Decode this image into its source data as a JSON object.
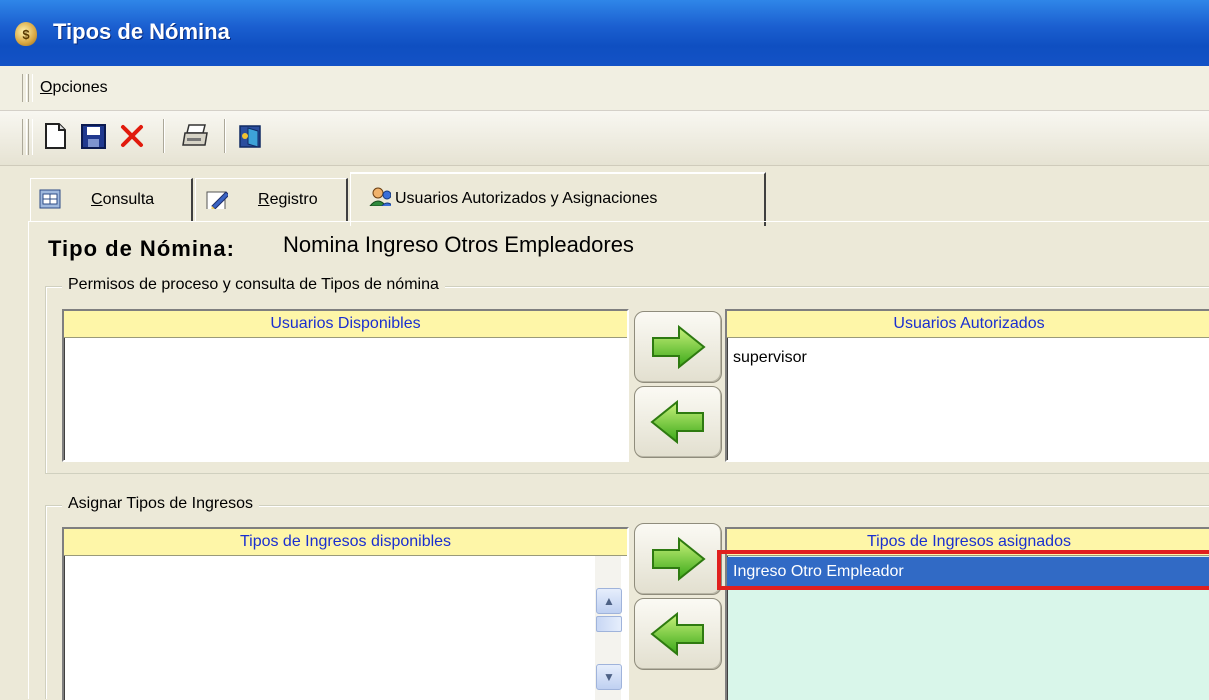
{
  "window": {
    "title": "Tipos de Nómina",
    "icon": "money-bag-icon"
  },
  "menu": {
    "items": [
      {
        "label_underlined": "O",
        "label_rest": "pciones"
      }
    ]
  },
  "toolbar": {
    "buttons": [
      "new-document-icon",
      "save-disk-icon",
      "delete-x-icon",
      "print-icon",
      "exit-door-icon"
    ]
  },
  "tabs": [
    {
      "underlined": "C",
      "rest": "onsulta",
      "icon": "query-grid-icon",
      "active": false
    },
    {
      "underlined": "R",
      "rest": "egistro",
      "icon": "edit-pencil-icon",
      "active": false
    },
    {
      "label": "Usuarios Autorizados y Asignaciones",
      "icon": "users-icon",
      "active": true
    }
  ],
  "tipo_nomina": {
    "label": "Tipo de Nómina:",
    "value": "Nomina Ingreso Otros Empleadores"
  },
  "permisos": {
    "title": "Permisos de proceso y consulta de Tipos de nómina",
    "available_header": "Usuarios Disponibles",
    "authorized_header": "Usuarios Autorizados",
    "available_items": [],
    "authorized_items": [
      "supervisor"
    ]
  },
  "ingresos": {
    "title": "Asignar Tipos de Ingresos",
    "available_header": "Tipos de Ingresos disponibles",
    "assigned_header": "Tipos de Ingresos asignados",
    "assigned_items": [
      "Ingreso Otro Empleador"
    ]
  },
  "colors": {
    "highlight": "#316ac5",
    "selection_outline": "#e0201e",
    "header_bg": "#fef6a8",
    "assigned_bg": "#d9f6ea"
  }
}
